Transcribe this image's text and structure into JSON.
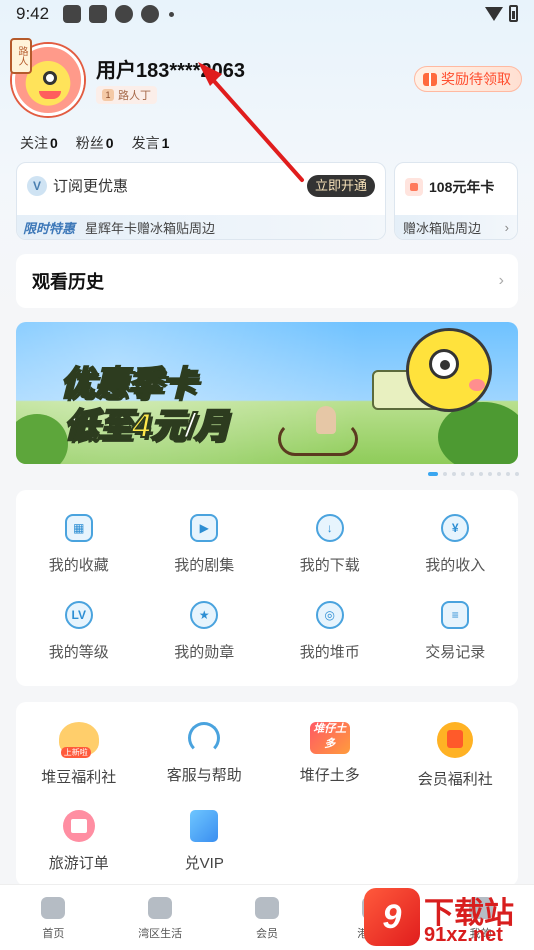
{
  "status_bar": {
    "time": "9:42"
  },
  "profile": {
    "avatar_badge": "路人",
    "username": "用户183****2063",
    "level_num": "1",
    "level_name": "路人丁",
    "reward_label": "奖励待领取"
  },
  "stats": [
    {
      "label": "关注",
      "value": "0"
    },
    {
      "label": "粉丝",
      "value": "0"
    },
    {
      "label": "发言",
      "value": "1"
    }
  ],
  "vip_card": {
    "title": "订阅更优惠",
    "open_button": "立即开通",
    "limited_label": "限时特惠",
    "limited_desc": "星辉年卡赠冰箱贴周边"
  },
  "year_card": {
    "title": "108元年卡",
    "desc": "赠冰箱贴周边"
  },
  "history": {
    "title": "观看历史"
  },
  "banner": {
    "line1": "优惠季卡",
    "line2_prefix": "低至",
    "line2_highlight": "4元",
    "line2_suffix": "/月"
  },
  "my_grid": [
    {
      "name": "favorites",
      "label": "我的收藏",
      "icon": "film-icon"
    },
    {
      "name": "series",
      "label": "我的剧集",
      "icon": "tv-icon"
    },
    {
      "name": "downloads",
      "label": "我的下载",
      "icon": "download-icon"
    },
    {
      "name": "income",
      "label": "我的收入",
      "icon": "yen-icon"
    },
    {
      "name": "level",
      "label": "我的等级",
      "icon": "lv-icon"
    },
    {
      "name": "medals",
      "label": "我的勋章",
      "icon": "medal-icon"
    },
    {
      "name": "coins",
      "label": "我的堆币",
      "icon": "coin-icon"
    },
    {
      "name": "transactions",
      "label": "交易记录",
      "icon": "list-icon"
    }
  ],
  "service_grid": [
    {
      "name": "bean-welfare",
      "label": "堆豆福利社",
      "badge": "上新啦"
    },
    {
      "name": "customer-service",
      "label": "客服与帮助"
    },
    {
      "name": "duizai-tuduo",
      "label": "堆仔土多",
      "icon_text": "堆仔土多"
    },
    {
      "name": "member-welfare",
      "label": "会员福利社"
    },
    {
      "name": "travel-orders",
      "label": "旅游订单"
    },
    {
      "name": "redeem-vip",
      "label": "兑VIP"
    }
  ],
  "tabbar": [
    {
      "name": "home",
      "label": "首页"
    },
    {
      "name": "bay-life",
      "label": "湾区生活"
    },
    {
      "name": "member",
      "label": "会员"
    },
    {
      "name": "hk-circle",
      "label": "港圈子"
    },
    {
      "name": "mine",
      "label": "我的"
    }
  ],
  "watermark": {
    "logo": "9",
    "text1": "下载站",
    "text2": "91xz.net"
  },
  "colors": {
    "accent": "#3aa6f0",
    "reward": "#ff4e2f",
    "arrow": "#e01d1d"
  }
}
